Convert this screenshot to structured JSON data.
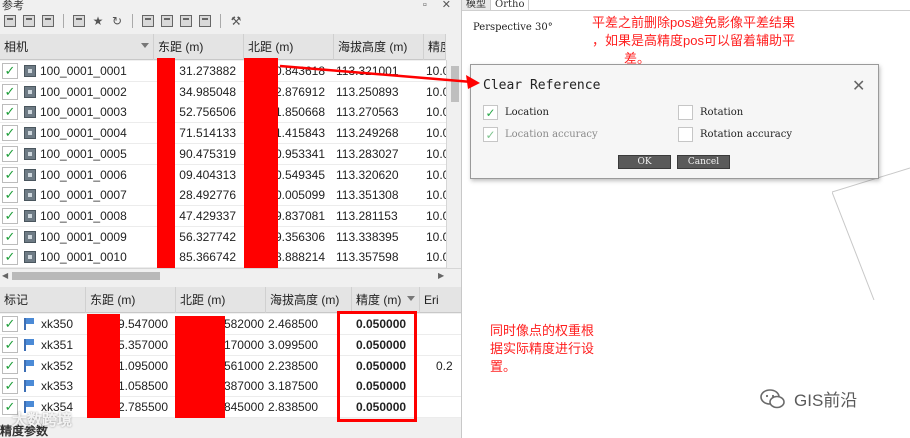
{
  "panel": {
    "title": "参考",
    "window_buttons": "▫ ✕"
  },
  "camera_table": {
    "headers": [
      "相机",
      "东距 (m)",
      "北距 (m)",
      "海拔高度 (m)",
      "精度"
    ],
    "rows": [
      {
        "label": "100_0001_0001",
        "east": "31.273882",
        "north": "40.843618",
        "alt": "113.321001",
        "acc": "10.0"
      },
      {
        "label": "100_0001_0002",
        "east": "34.985048",
        "north": "42.876912",
        "alt": "113.250893",
        "acc": "10.0"
      },
      {
        "label": "100_0001_0003",
        "east": "52.756506",
        "north": "51.850668",
        "alt": "113.270563",
        "acc": "10.0"
      },
      {
        "label": "100_0001_0004",
        "east": "71.514133",
        "north": "51.415843",
        "alt": "113.249268",
        "acc": "10.0"
      },
      {
        "label": "100_0001_0005",
        "east": "90.475319",
        "north": "70.953341",
        "alt": "113.283027",
        "acc": "10.0"
      },
      {
        "label": "100_0001_0006",
        "east": "09.404313",
        "north": "80.549345",
        "alt": "113.320620",
        "acc": "10.0"
      },
      {
        "label": "100_0001_0007",
        "east": "28.492776",
        "north": "90.005099",
        "alt": "113.351308",
        "acc": "10.0"
      },
      {
        "label": "100_0001_0008",
        "east": "47.429337",
        "north": "99.837081",
        "alt": "113.281153",
        "acc": "10.0"
      },
      {
        "label": "100_0001_0009",
        "east": "56.327742",
        "north": "09.356306",
        "alt": "113.338395",
        "acc": "10.0"
      },
      {
        "label": "100_0001_0010",
        "east": "85.366742",
        "north": "18.888214",
        "alt": "113.357598",
        "acc": "10.0"
      }
    ]
  },
  "marker_table": {
    "headers": [
      "标记",
      "东距 (m)",
      "北距 (m)",
      "海拔高度 (m)",
      "精度 (m)",
      "Eri"
    ],
    "rows": [
      {
        "label": "xk350",
        "east": "9.547000",
        "north": "582000",
        "alt": "2.468500",
        "acc": "0.050000",
        "err": ""
      },
      {
        "label": "xk351",
        "east": "5.357000",
        "north": "170000",
        "alt": "3.099500",
        "acc": "0.050000",
        "err": ""
      },
      {
        "label": "xk352",
        "east": "1.095000",
        "north": "561000",
        "alt": "2.238500",
        "acc": "0.050000",
        "err": "0.2"
      },
      {
        "label": "xk353",
        "east": "1.058500",
        "north": "387000",
        "alt": "3.187500",
        "acc": "0.050000",
        "err": ""
      },
      {
        "label": "xk354",
        "east": "2.785500",
        "north": "845000",
        "alt": "2.838500",
        "acc": "0.050000",
        "err": ""
      }
    ]
  },
  "bottom_label": "精度参数",
  "viewport": {
    "tabs": [
      "模型",
      "Ortho"
    ],
    "perspective": "Perspective 30°"
  },
  "dialog": {
    "title": "Clear Reference",
    "close": "✕",
    "options": [
      {
        "label": "Location",
        "checked": true,
        "disabled": false
      },
      {
        "label": "Rotation",
        "checked": false,
        "disabled": false
      },
      {
        "label": "Location accuracy",
        "checked": true,
        "disabled": true
      },
      {
        "label": "Rotation accuracy",
        "checked": false,
        "disabled": false
      }
    ],
    "ok": "OK",
    "cancel": "Cancel"
  },
  "annotations": {
    "note_top": [
      "平差之前删除pos避免影像平差结果",
      "，如果是高精度pos可以留着辅助平",
      "差。"
    ],
    "note_bottom": [
      "同时像点的权重根",
      "据实际精度进行设",
      "置。"
    ]
  },
  "watermark": {
    "brand": "GIS前沿",
    "bottom_text": "大数跨境"
  },
  "colors": {
    "annotation_red": "#ff0000",
    "check_green": "#1f9e3a",
    "button_dark": "#5a5a5a"
  }
}
